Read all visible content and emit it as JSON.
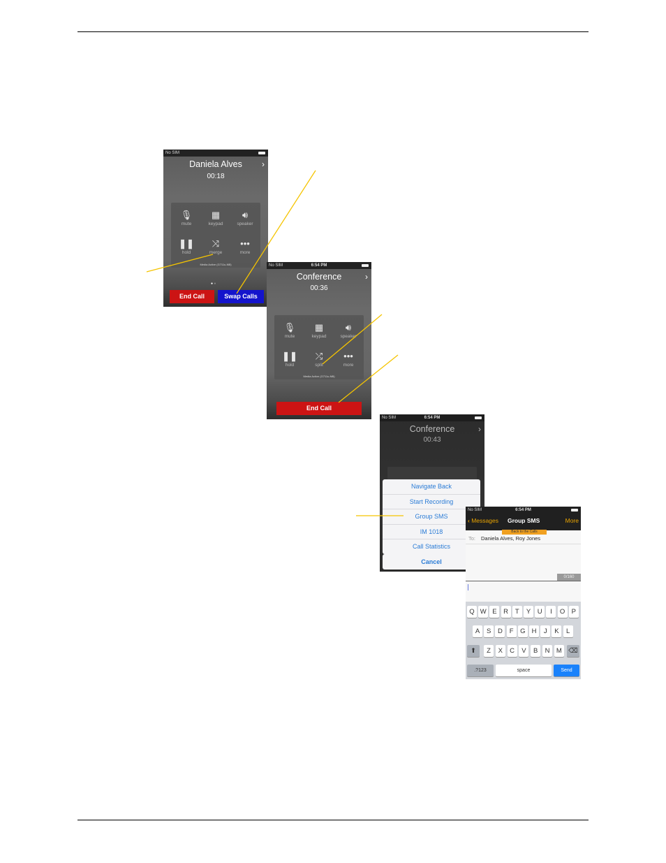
{
  "screen1": {
    "carrier": "No SIM",
    "title": "Daniela Alves",
    "timer": "00:18",
    "controls": [
      {
        "label": "mute",
        "icon": "microphone-icon"
      },
      {
        "label": "keypad",
        "icon": "keypad-icon"
      },
      {
        "label": "speaker",
        "icon": "speaker-icon"
      },
      {
        "label": "hold",
        "icon": "pause-icon"
      },
      {
        "label": "merge",
        "icon": "merge-icon"
      },
      {
        "label": "more",
        "icon": "more-icon"
      }
    ],
    "media_status": "Media Active (G711u-NB)",
    "end_call": "End Call",
    "swap_calls": "Swap Calls",
    "page_indicator": {
      "current": 1,
      "total": 2
    }
  },
  "screen2": {
    "carrier": "No SIM",
    "time": "6:54 PM",
    "title": "Conference",
    "timer": "00:36",
    "controls": [
      {
        "label": "mute",
        "icon": "microphone-icon"
      },
      {
        "label": "keypad",
        "icon": "keypad-icon"
      },
      {
        "label": "speaker",
        "icon": "speaker-icon"
      },
      {
        "label": "hold",
        "icon": "pause-icon"
      },
      {
        "label": "split",
        "icon": "split-icon"
      },
      {
        "label": "more",
        "icon": "more-icon"
      }
    ],
    "media_status": "Media Active (G711u-NB)",
    "end_call": "End Call"
  },
  "screen3": {
    "carrier": "No SIM",
    "time": "6:54 PM",
    "title": "Conference",
    "timer": "00:43",
    "menu": [
      "Navigate Back",
      "Start Recording",
      "Group SMS",
      "IM 1018",
      "Call Statistics"
    ],
    "cancel": "Cancel"
  },
  "screen4": {
    "carrier": "No SIM",
    "time": "6:54 PM",
    "back_label": "Messages",
    "title": "Group SMS",
    "more_label": "More",
    "tooltip": "Back to the Calls",
    "to_label": "To:",
    "recipients": "Daniela Alves, Roy Jones",
    "char_counter": "0/160",
    "keyboard": {
      "row1": [
        "Q",
        "W",
        "E",
        "R",
        "T",
        "Y",
        "U",
        "I",
        "O",
        "P"
      ],
      "row2": [
        "A",
        "S",
        "D",
        "F",
        "G",
        "H",
        "J",
        "K",
        "L"
      ],
      "row3": [
        "Z",
        "X",
        "C",
        "V",
        "B",
        "N",
        "M"
      ],
      "numbers_key": ".?123",
      "space_key": "space",
      "send_key": "Send"
    }
  },
  "colors": {
    "callout_line": "#f5c400",
    "end_call": "#cc1414",
    "swap_calls": "#1414cc",
    "action_text": "#2b7cd6",
    "nav_accent": "#e8a300",
    "send_key": "#1a82fb"
  }
}
